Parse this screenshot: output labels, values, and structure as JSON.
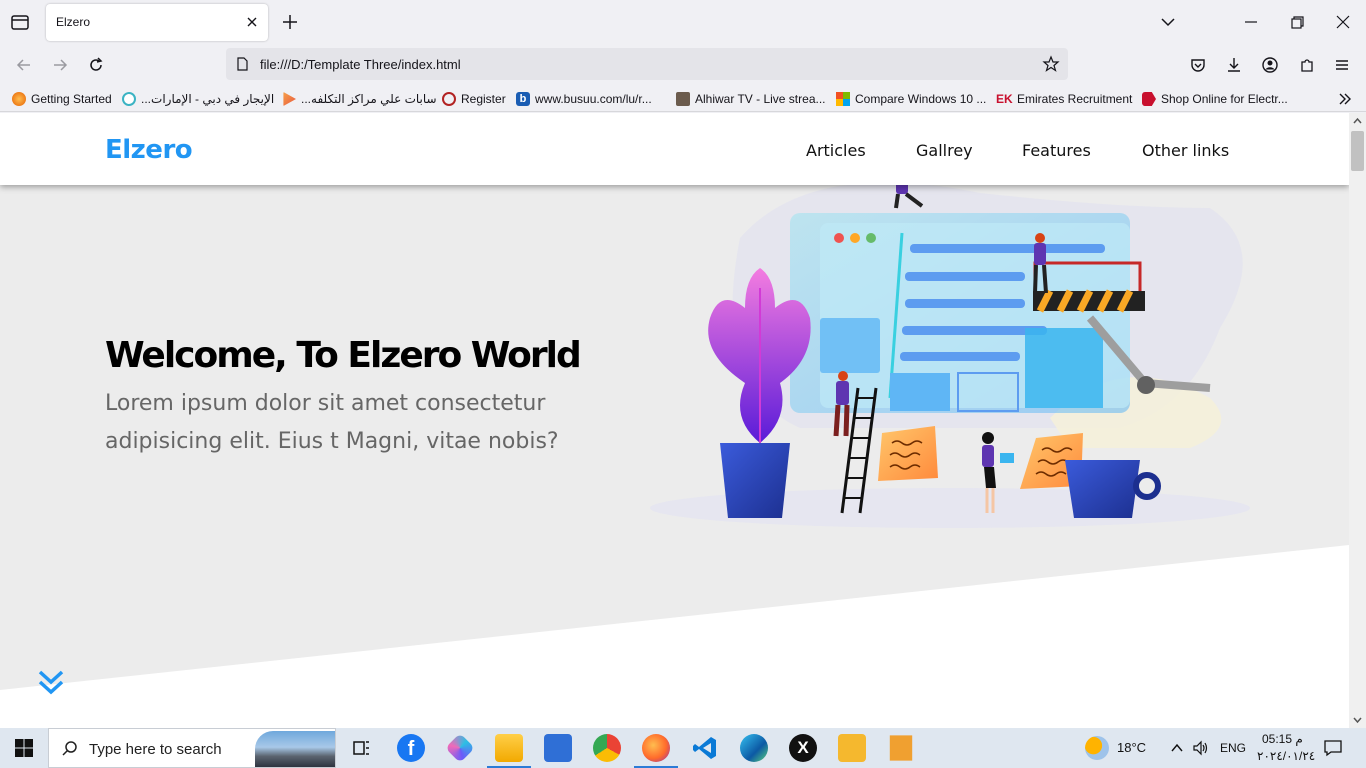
{
  "browser": {
    "tab": {
      "title": "Elzero"
    },
    "url": "file:///D:/Template Three/index.html",
    "bookmarks": [
      {
        "label": "Getting Started",
        "icon": "firefox-icon",
        "color": "#e66000"
      },
      {
        "label": "...الإيجار في دبي - الإمارات",
        "icon": "leaf-icon",
        "color": "#3bb3c3"
      },
      {
        "label": "...سابات علي مراكز التكلفه",
        "icon": "play-icon",
        "color": "#e8583d"
      },
      {
        "label": "Register",
        "icon": "apple-icon",
        "color": "#b22222"
      },
      {
        "label": "www.busuu.com/lu/r...",
        "icon": "busuu-icon",
        "color": "#1a5db3"
      },
      {
        "label": "Alhiwar TV - Live strea...",
        "icon": "tv-icon",
        "color": "#6b5b4d"
      },
      {
        "label": "Compare Windows 10 ...",
        "icon": "windows-icon",
        "color": "#f25022"
      },
      {
        "label": "Emirates Recruitment",
        "icon": "ek-icon",
        "color": "#c8102e"
      },
      {
        "label": "Shop Online for Electr...",
        "icon": "shop-icon",
        "color": "#c8102e"
      }
    ]
  },
  "site": {
    "logo": "Elzero",
    "nav": [
      "Articles",
      "Gallrey",
      "Features",
      "Other links"
    ],
    "hero": {
      "title": "Welcome, To Elzero World",
      "text": "Lorem ipsum dolor sit amet consectetur adipisicing elit. Eius t Magni, vitae nobis?"
    },
    "colors": {
      "brand": "#2196f3",
      "heading": "#000000",
      "paragraph": "#666666",
      "hero_bg": "#ececec"
    }
  },
  "taskbar": {
    "search_placeholder": "Type here to search",
    "weather": "18°C",
    "language": "ENG",
    "time": "05:15 م",
    "date": "٢٠٢٤/٠١/٢٤",
    "apps": [
      "task-view-icon",
      "facebook-icon",
      "copilot-icon",
      "file-explorer-icon",
      "microsoft-store-icon",
      "chrome-icon",
      "firefox-icon",
      "vscode-icon",
      "edge-icon",
      "x-icon",
      "notes-app-icon",
      "media-player-icon"
    ]
  }
}
